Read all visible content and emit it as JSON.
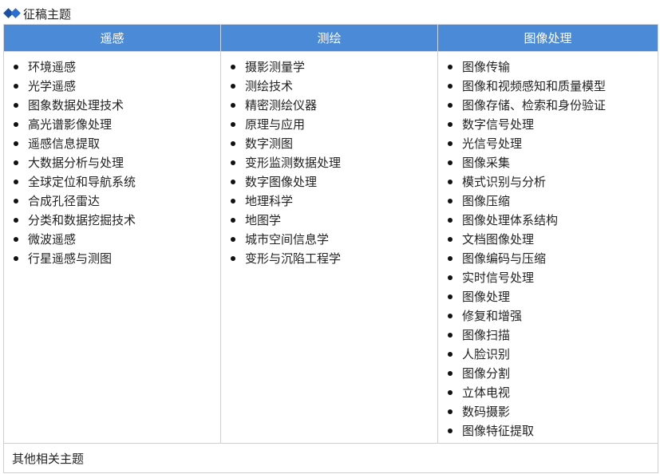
{
  "section": {
    "title": "征稿主题",
    "icon": "double-diamond-icon"
  },
  "columns": [
    {
      "header": "遥感",
      "items": [
        "环境遥感",
        "光学遥感",
        "图象数据处理技术",
        "高光谱影像处理",
        "遥感信息提取",
        "大数据分析与处理",
        "全球定位和导航系统",
        "合成孔径雷达",
        "分类和数据挖掘技术",
        "微波遥感",
        "行星遥感与测图"
      ]
    },
    {
      "header": "测绘",
      "items": [
        "摄影测量学",
        "测绘技术",
        "精密测绘仪器",
        "原理与应用",
        "数字测图",
        "变形监测数据处理",
        "数字图像处理",
        "地理科学",
        "地图学",
        "城市空间信息学",
        "变形与沉陷工程学"
      ]
    },
    {
      "header": "图像处理",
      "items": [
        "图像传输",
        "图像和视频感知和质量模型",
        "图像存储、检索和身份验证",
        "数字信号处理",
        "光信号处理",
        "图像采集",
        "模式识别与分析",
        "图像压缩",
        "图像处理体系结构",
        "文档图像处理",
        "图像编码与压缩",
        "实时信号处理",
        "图像处理",
        "修复和增强",
        "图像扫描",
        "人脸识别",
        "图像分割",
        "立体电视",
        "数码摄影",
        "图像特征提取"
      ]
    }
  ],
  "footer": {
    "text": "其他相关主题"
  },
  "colors": {
    "header_bg": "#4a8ad6",
    "header_text": "#ffffff",
    "icon_dark": "#1a4fa3",
    "icon_light": "#2a6fd1",
    "border": "#cfcfcf"
  }
}
